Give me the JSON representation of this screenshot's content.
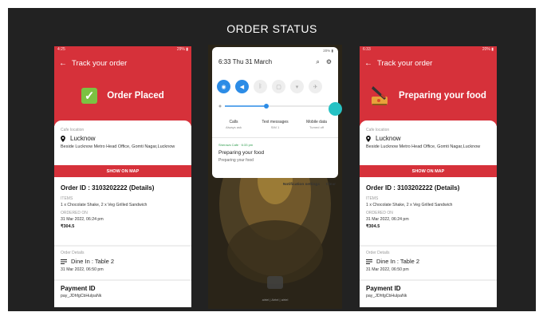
{
  "page": {
    "title": "ORDER STATUS"
  },
  "left_phone": {
    "status_left": "4:25",
    "status_right": "29% ▮",
    "header": "Track your order",
    "status_title": "Order Placed",
    "cafe_location_label": "Cafe location",
    "city": "Lucknow",
    "address": "Beside Lucknow Metro Head Office, Gomti Nagar,Lucknow",
    "map_button": "SHOW ON MAP",
    "order_id": "Order ID : 3103202222 (Details)",
    "items_label": "ITEMS",
    "items": "1 x Chocolate Shake, 2 x Veg Grilled Sandwich",
    "ordered_on_label": "ORDERED ON",
    "ordered_on": "31 Mar 2022, 06:24 pm",
    "amount": "₹304.5",
    "order_details_label": "Order Details",
    "dine_in": "Dine In : Table 2",
    "details_time": "31 Mar 2022, 06:50 pm",
    "payment_title": "Payment ID",
    "payment_id": "pay_JDhfgCbHulpaNk"
  },
  "middle_phone": {
    "status_right": "20% ▮",
    "time": "6:33",
    "date": "Thu 31 March",
    "calls_label": "Calls",
    "calls_sub": "Always ask",
    "texts_label": "Text messages",
    "texts_sub": "SIM 1",
    "mobile_label": "Mobile data",
    "mobile_sub": "Turned off",
    "notif_app": "Sherows Cafe · 6:33 pm",
    "notif_title": "Preparing your food",
    "notif_body": "Preparing your food",
    "notif_settings": "Notification settings",
    "notif_clear": "Clear",
    "carrier": "airtel | Airtel | airtel"
  },
  "right_phone": {
    "status_left": "6:33",
    "status_right": "20% ▮",
    "header": "Track your order",
    "status_title": "Preparing your food",
    "cafe_location_label": "Cafe location",
    "city": "Lucknow",
    "address": "Beside Lucknow Metro Head Office, Gomti Nagar,Lucknow",
    "map_button": "SHOW ON MAP",
    "order_id": "Order ID : 3103202222 (Details)",
    "items_label": "ITEMS",
    "items": "1 x Chocolate Shake, 2 x Veg Grilled Sandwich",
    "ordered_on_label": "ORDERED ON",
    "ordered_on": "31 Mar 2022, 06:24 pm",
    "amount": "₹304.5",
    "order_details_label": "Order Details",
    "dine_in": "Dine In : Table 2",
    "details_time": "31 Mar 2022, 06:50 pm",
    "payment_title": "Payment ID",
    "payment_id": "pay_JDhfgCbHulpaNk"
  },
  "colors": {
    "brand_red": "#d6313a",
    "check_green": "#7cc242",
    "toggle_blue": "#2c8ce6",
    "slide_bg": "#222222"
  },
  "icons": [
    "back-arrow-icon",
    "check-icon",
    "knife-board-icon",
    "location-pin-icon",
    "menu-lines-icon",
    "wifi-icon",
    "sound-icon",
    "bluetooth-icon",
    "search-icon",
    "gear-icon"
  ]
}
